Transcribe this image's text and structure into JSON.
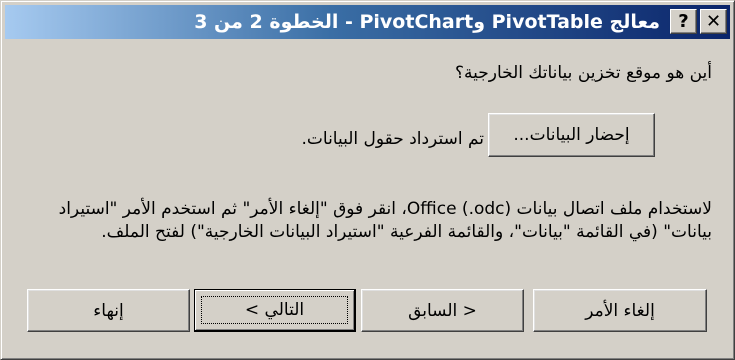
{
  "window": {
    "title": "معالج PivotTable وPivotChart - الخطوة 2 من 3",
    "help_glyph": "?",
    "close_glyph": "✕"
  },
  "content": {
    "question": "أين هو موقع تخزين بياناتك الخارجية؟",
    "get_data_label": "إحضار البيانات...",
    "status": "تم استرداد حقول البيانات.",
    "instructions": "لاستخدام ملف اتصال بيانات Office ‎(.odc)‏، انقر فوق \"إلغاء الأمر\" ثم استخدم الأمر \"استيراد بيانات\" (في القائمة \"بيانات\"، والقائمة الفرعية \"استيراد البيانات الخارجية\") لفتح الملف."
  },
  "buttons": {
    "cancel": "إلغاء الأمر",
    "back": "< السابق",
    "next": "التالي >",
    "finish": "إنهاء"
  }
}
